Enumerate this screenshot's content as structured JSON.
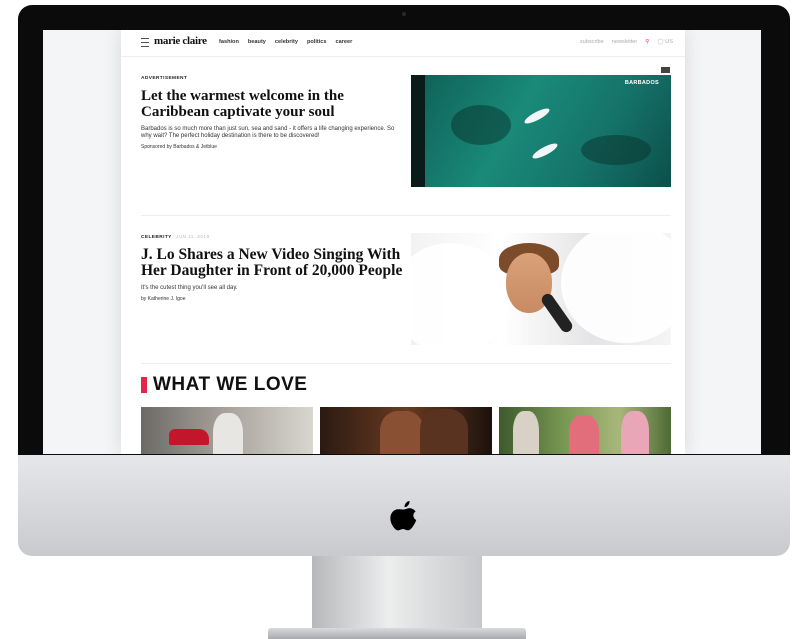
{
  "site": {
    "brand": "marie claire",
    "nav": [
      "fashion",
      "beauty",
      "celebrity",
      "politics",
      "career"
    ],
    "right_links": [
      "subscribe",
      "newsletter"
    ],
    "region": "US"
  },
  "ad": {
    "kicker": "ADVERTISEMENT",
    "headline": "Let the warmest welcome in the Caribbean captivate your soul",
    "dek": "Barbados is so much more than just sun, sea and sand - it offers a life changing experience. So why wait? The perfect holiday destination is there to be discovered!",
    "sponsor": "Sponsored by Barbados & Jetblue",
    "image_tag": "BARBADOS"
  },
  "article": {
    "kicker": "CELEBRITY",
    "date": "JUN 11, 2019",
    "headline": "J. Lo Shares a New Video Singing With Her Daughter in Front of 20,000 People",
    "dek": "It's the cutest thing you'll see all day.",
    "byline": "by Katherine J. Igoe"
  },
  "section": {
    "title": "WHAT WE LOVE"
  },
  "colors": {
    "accent": "#e3254a",
    "bezel": "#0b0b0c",
    "ocean": "#1a8a78"
  },
  "icons": [
    "hamburger-menu-icon",
    "search-icon",
    "globe-icon",
    "apple-logo-icon"
  ]
}
